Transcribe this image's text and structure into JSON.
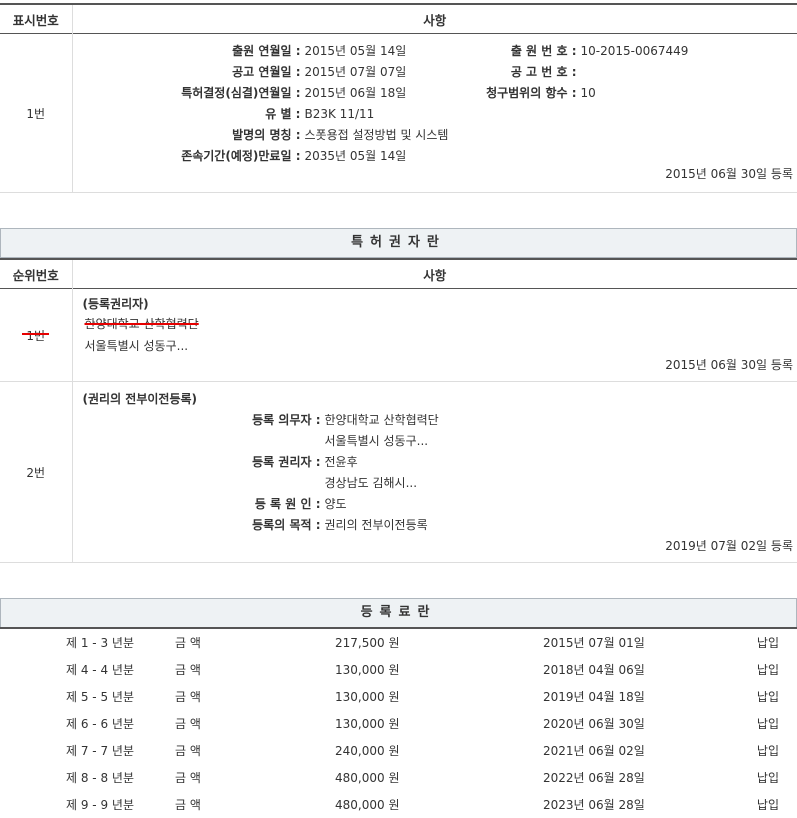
{
  "main": {
    "headers": {
      "col1": "표시번호",
      "col2": "사항"
    },
    "row_no": "1번",
    "left_fields": [
      {
        "label": "출원 연월일 :",
        "value": "2015년 05월 14일"
      },
      {
        "label": "공고 연월일 :",
        "value": "2015년 07월 07일"
      },
      {
        "label": "특허결정(심결)연월일 :",
        "value": "2015년 06월 18일"
      },
      {
        "label": "유 별 :",
        "value": "B23K 11/11"
      },
      {
        "label": "발명의 명칭 :",
        "value": "스폿용접 설정방법 및 시스템"
      },
      {
        "label": "존속기간(예정)만료일 :",
        "value": "2035년 05월 14일"
      }
    ],
    "right_fields": [
      {
        "label": "출 원 번 호 :",
        "value": "10-2015-0067449"
      },
      {
        "label": "공 고 번 호 :",
        "value": ""
      },
      {
        "label": "청구범위의 항수 :",
        "value": "10"
      }
    ],
    "reg_date": "2015년 06월 30일 등록"
  },
  "owners": {
    "title": "특허권자란",
    "headers": {
      "col1": "순위번호",
      "col2": "사항"
    },
    "rows": [
      {
        "no": "1번",
        "heading": "(등록권리자)",
        "name": "한양대학교 산학협력단",
        "address": "서울특별시 성동구...",
        "reg_date": "2015년 06월 30일 등록"
      },
      {
        "no": "2번",
        "heading": "(권리의 전부이전등록)",
        "fields": [
          {
            "label": "등록 의무자 :",
            "value": "한양대학교 산학협력단"
          },
          {
            "label": "",
            "value": "서울특별시 성동구..."
          },
          {
            "label": "등록 권리자 :",
            "value": "전윤후"
          },
          {
            "label": "",
            "value": "경상남도 김해시..."
          },
          {
            "label": "등 록 원 인 :",
            "value": "양도"
          },
          {
            "label": "등록의 목적 :",
            "value": "권리의 전부이전등록"
          }
        ],
        "reg_date": "2019년 07월 02일 등록"
      }
    ]
  },
  "fees": {
    "title": "등록료란",
    "rows": [
      {
        "period": "제 1 - 3 년분",
        "amount_label": "금 액",
        "amount": "217,500 원",
        "date": "2015년 07월 01일",
        "status": "납입"
      },
      {
        "period": "제 4 - 4 년분",
        "amount_label": "금 액",
        "amount": "130,000 원",
        "date": "2018년 04월 06일",
        "status": "납입"
      },
      {
        "period": "제 5 - 5 년분",
        "amount_label": "금 액",
        "amount": "130,000 원",
        "date": "2019년 04월 18일",
        "status": "납입"
      },
      {
        "period": "제 6 - 6 년분",
        "amount_label": "금 액",
        "amount": "130,000 원",
        "date": "2020년 06월 30일",
        "status": "납입"
      },
      {
        "period": "제 7 - 7 년분",
        "amount_label": "금 액",
        "amount": "240,000 원",
        "date": "2021년 06월 02일",
        "status": "납입"
      },
      {
        "period": "제 8 - 8 년분",
        "amount_label": "금 액",
        "amount": "480,000 원",
        "date": "2022년 06월 28일",
        "status": "납입"
      },
      {
        "period": "제 9 - 9 년분",
        "amount_label": "금 액",
        "amount": "480,000 원",
        "date": "2023년 06월 28일",
        "status": "납입"
      }
    ]
  }
}
